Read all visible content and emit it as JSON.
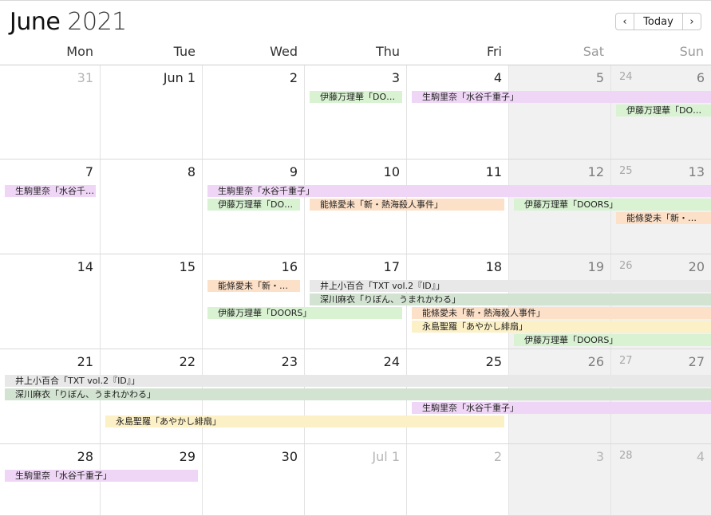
{
  "header": {
    "month": "June",
    "year": "2021",
    "prev_icon": "‹",
    "today_label": "Today",
    "next_icon": "›"
  },
  "weekdays": [
    "Mon",
    "Tue",
    "Wed",
    "Thu",
    "Fri",
    "Sat",
    "Sun"
  ],
  "colors": {
    "purple": "#efd6f6",
    "green": "#d8f2d2",
    "orange": "#fde0c8",
    "gray": "#e8e8e8",
    "sage": "#d2e3d1",
    "yellow": "#fcf0c6"
  },
  "weeks": [
    {
      "week_number": "24",
      "days": [
        "31",
        "Jun 1",
        "2",
        "3",
        "4",
        "5",
        "6"
      ],
      "events": [
        {
          "label": "伊藤万理華「DO…",
          "start": 3,
          "span": 1,
          "row": 0,
          "color": "green"
        },
        {
          "label": "生駒里奈「水谷千重子」",
          "start": 4,
          "span": 3,
          "row": 0,
          "color": "purple"
        },
        {
          "label": "伊藤万理華「DO…",
          "start": 6,
          "span": 1,
          "row": 1,
          "color": "green"
        }
      ]
    },
    {
      "week_number": "25",
      "days": [
        "7",
        "8",
        "9",
        "10",
        "11",
        "12",
        "13"
      ],
      "events": [
        {
          "label": "生駒里奈「水谷千…",
          "start": 0,
          "span": 1,
          "row": 0,
          "color": "purple"
        },
        {
          "label": "生駒里奈「水谷千重子」",
          "start": 2,
          "span": 5,
          "row": 0,
          "color": "purple"
        },
        {
          "label": "伊藤万理華「DO…",
          "start": 2,
          "span": 1,
          "row": 1,
          "color": "green"
        },
        {
          "label": "能條愛未「新・熱海殺人事件」",
          "start": 3,
          "span": 2,
          "row": 1,
          "color": "orange"
        },
        {
          "label": "伊藤万理華「DOORS」",
          "start": 5,
          "span": 2,
          "row": 1,
          "color": "green"
        },
        {
          "label": "能條愛未「新・…",
          "start": 6,
          "span": 1,
          "row": 2,
          "color": "orange"
        }
      ]
    },
    {
      "week_number": "26",
      "days": [
        "14",
        "15",
        "16",
        "17",
        "18",
        "19",
        "20"
      ],
      "events": [
        {
          "label": "能條愛未「新・…",
          "start": 2,
          "span": 1,
          "row": 0,
          "color": "orange"
        },
        {
          "label": "井上小百合「TXT vol.2『ID』」",
          "start": 3,
          "span": 4,
          "row": 0,
          "color": "gray"
        },
        {
          "label": "深川麻衣「りぼん、うまれかわる」",
          "start": 3,
          "span": 4,
          "row": 1,
          "color": "sage"
        },
        {
          "label": "伊藤万理華「DOORS」",
          "start": 2,
          "span": 2,
          "row": 2,
          "color": "green"
        },
        {
          "label": "能條愛未「新・熱海殺人事件」",
          "start": 4,
          "span": 3,
          "row": 2,
          "color": "orange"
        },
        {
          "label": "永島聖羅「あやかし緋扇」",
          "start": 4,
          "span": 3,
          "row": 3,
          "color": "yellow"
        },
        {
          "label": "伊藤万理華「DOORS」",
          "start": 5,
          "span": 2,
          "row": 4,
          "color": "green"
        }
      ]
    },
    {
      "week_number": "27",
      "days": [
        "21",
        "22",
        "23",
        "24",
        "25",
        "26",
        "27"
      ],
      "events": [
        {
          "label": "井上小百合「TXT vol.2『ID』」",
          "start": 0,
          "span": 7,
          "row": 0,
          "color": "gray"
        },
        {
          "label": "深川麻衣「りぼん、うまれかわる」",
          "start": 0,
          "span": 7,
          "row": 1,
          "color": "sage"
        },
        {
          "label": "生駒里奈「水谷千重子」",
          "start": 4,
          "span": 3,
          "row": 2,
          "color": "purple"
        },
        {
          "label": "永島聖羅「あやかし緋扇」",
          "start": 1,
          "span": 4,
          "row": 3,
          "color": "yellow"
        }
      ]
    },
    {
      "week_number": "28",
      "days": [
        "28",
        "29",
        "30",
        "Jul 1",
        "2",
        "3",
        "4"
      ],
      "events": [
        {
          "label": "生駒里奈「水谷千重子」",
          "start": 0,
          "span": 2,
          "row": 0,
          "color": "purple"
        }
      ]
    }
  ]
}
